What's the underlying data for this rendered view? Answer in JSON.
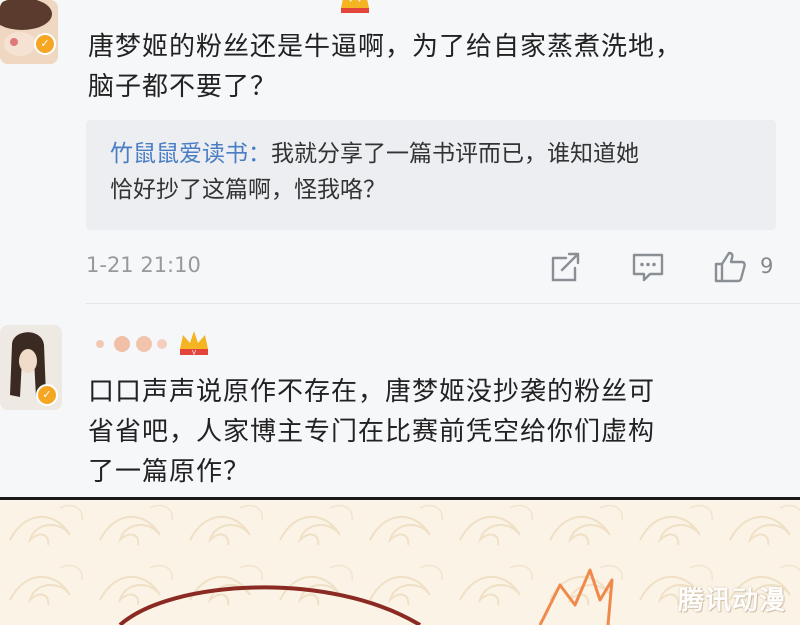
{
  "comment1": {
    "line1": "唐梦姬的粉丝还是牛逼啊，为了给自家蒸煮洗地，",
    "line2": "脑子都不要了？",
    "quote_user": "竹鼠鼠爱读书：",
    "quote_line1": "我就分享了一篇书评而已，谁知道她",
    "quote_line2": "恰好抄了这篇啊，怪我咯？",
    "time": "1-21 21:10",
    "like_count": "9"
  },
  "comment2": {
    "line1": "口口声声说原作不存在，唐梦姬没抄袭的粉丝可",
    "line2": "省省吧，人家博主专门在比赛前凭空给你们虚构",
    "line3": "了一篇原作？"
  },
  "watermark": "腾讯动漫",
  "colors": {
    "accent_link": "#4a7ec4",
    "vip_gold": "#f5a623",
    "crown_red": "#e2463a",
    "panel_bg": "#f6f7f9",
    "manga_bg": "#fbf3e6"
  },
  "icons": [
    "vip-badge-icon",
    "crown-icon",
    "repost-icon",
    "comment-icon",
    "thumbs-up-icon"
  ]
}
